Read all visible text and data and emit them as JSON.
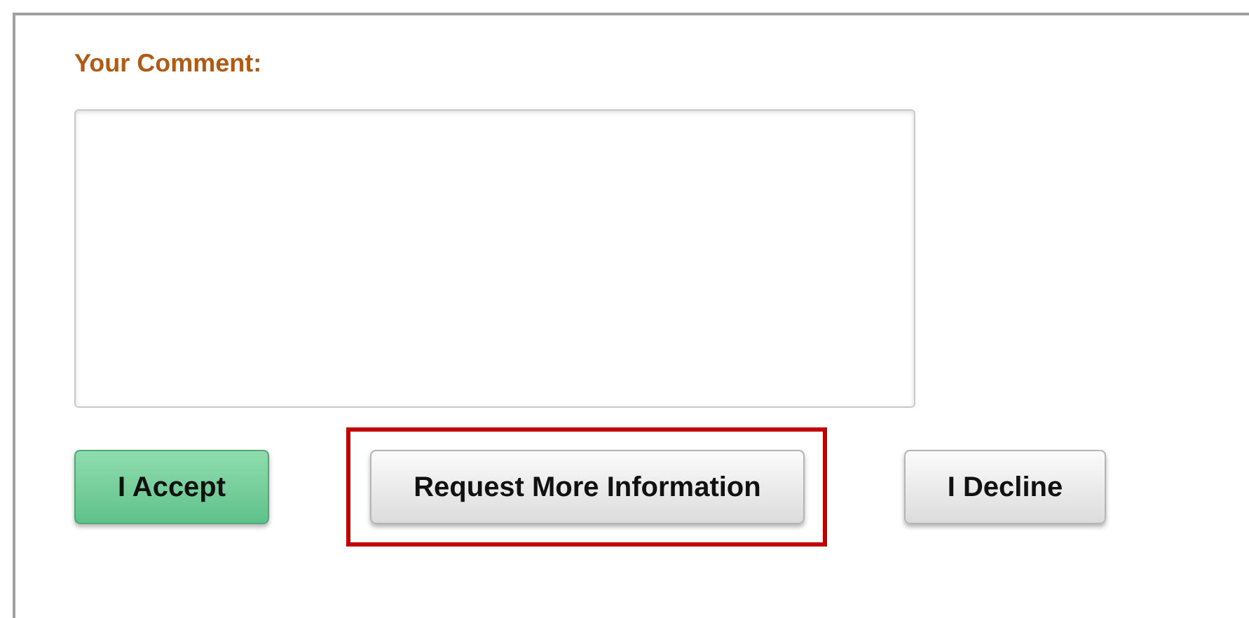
{
  "comment": {
    "label": "Your Comment:"
  },
  "buttons": [
    {
      "label": "I Accept",
      "kind": "primary",
      "highlighted": false
    },
    {
      "label": "Request More Information",
      "kind": "default",
      "highlighted": true
    },
    {
      "label": "I Decline",
      "kind": "default",
      "highlighted": false
    }
  ]
}
